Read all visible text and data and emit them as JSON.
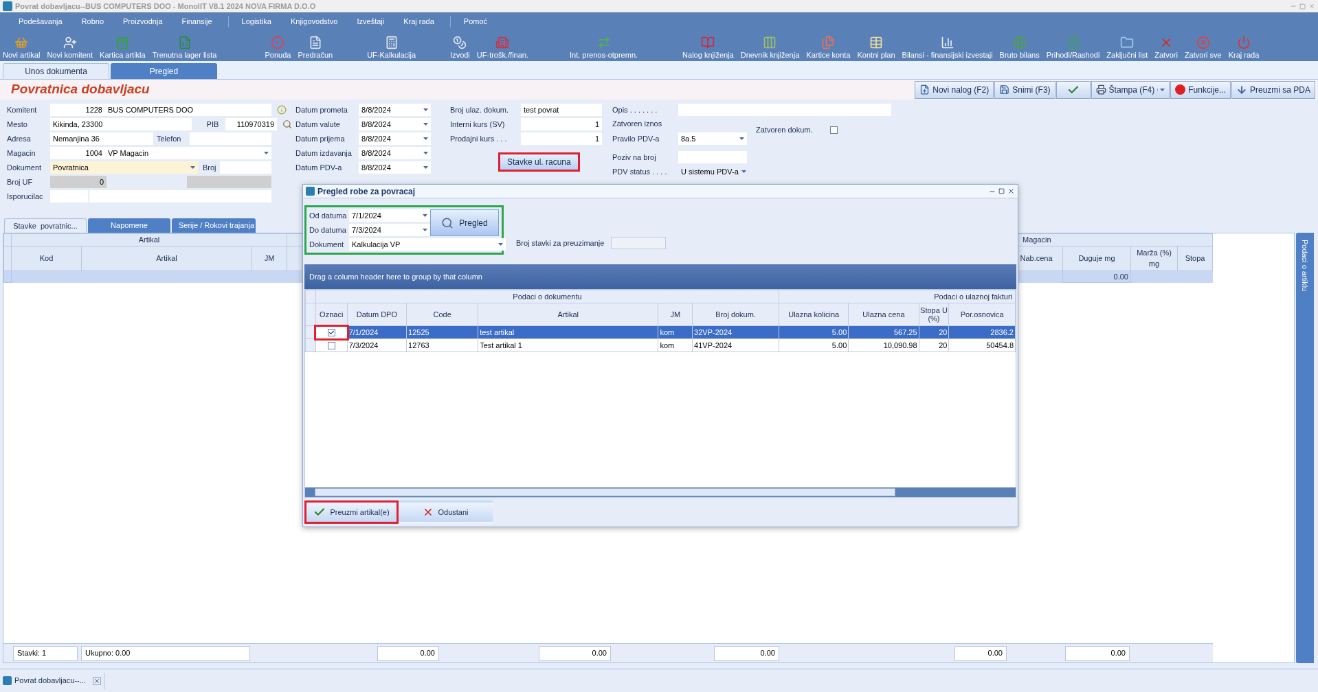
{
  "window": {
    "title": "Povrat dobavljacu--BUS COMPUTERS DOO - MonolIT V8.1 2024 NOVA FIRMA D.O.O"
  },
  "menu": [
    [
      "Podešavanja",
      "Robno",
      "Proizvodnja",
      "Finansije"
    ],
    [
      "Logistika",
      "Knjigovodstvo",
      "Izveštaji",
      "Kraj rada"
    ],
    [
      "Pomoć"
    ]
  ],
  "toolbar": [
    "Novi artikal",
    "Novi komitent",
    "Kartica artikla",
    "Trenutna lager lista",
    "Ponuda",
    "Predračun",
    "UF-Kalkulacija",
    "Izvodi",
    "UF-trošk./finan.",
    "Int. prenos-otpremn.",
    "Nalog knjiženja",
    "Dnevnik knjiženja",
    "Kartice konta",
    "Kontni plan",
    "Bilansi - finansijski izvestaji",
    "Bruto bilans",
    "Prihodi/Rashodi",
    "Zaključni list",
    "Zatvori",
    "Zatvori sve",
    "Kraj rada"
  ],
  "doc_tabs": [
    {
      "label": "Unos dokumenta",
      "selected": true
    },
    {
      "label": "Pregled",
      "selected": false
    }
  ],
  "header": {
    "title": "Povratnica dobavljacu"
  },
  "actions": [
    {
      "kind": "button",
      "label": "Novi nalog (F2)"
    },
    {
      "kind": "button",
      "label": "Snimi (F3)"
    },
    {
      "kind": "confirm"
    },
    {
      "kind": "dropdown",
      "label": "Štampa (F4)"
    },
    {
      "kind": "button",
      "label": "Funkcije..."
    },
    {
      "kind": "button",
      "label": "Preuzmi sa PDA"
    }
  ],
  "partner": {
    "komitent_label": "Komitent",
    "komitent_code": "1228",
    "komitent_name": "BUS COMPUTERS DOO",
    "mesto_label": "Mesto",
    "mesto": "Kikinda, 23300",
    "pib_label": "PIB",
    "pib": "110970319",
    "adresa_label": "Adresa",
    "adresa": "Nemanjina 36",
    "telefon_label": "Telefon",
    "magacin_label": "Magacin",
    "magacin_code": "1004",
    "magacin_name": "VP Magacin",
    "dokument_label": "Dokument",
    "dokument": "Povratnica",
    "broj_label": "Broj",
    "broj_uf_label": "Broj UF",
    "broj_uf": "0",
    "isporucilac_label": "Isporucilac"
  },
  "dates": [
    {
      "label": "Datum prometa",
      "value": "8/8/2024"
    },
    {
      "label": "Datum valute",
      "value": "8/8/2024"
    },
    {
      "label": "Datum prijema",
      "value": "8/8/2024"
    },
    {
      "label": "Datum izdavanja",
      "value": "8/8/2024"
    },
    {
      "label": "Datum PDV-a",
      "value": "8/8/2024"
    }
  ],
  "invoice": {
    "fields": [
      {
        "label": "Broj ulaz. dokum.",
        "value": "test povrat"
      },
      {
        "label": "Interni kurs (SV)",
        "value": "1"
      },
      {
        "label": "Prodajni kurs . . .",
        "value": "1"
      }
    ],
    "button": {
      "label": "Stavke ul. racuna",
      "highlighted": true
    }
  },
  "extra": {
    "opis_label": "Opis . . . . . . .",
    "zatvoren_iznos_label": "Zatvoren iznos",
    "pravilo_label": "Pravilo PDV-a",
    "pravilo": "8a.5",
    "poziv_label": "Poziv na broj",
    "pdv_status_label": "PDV status . . . .",
    "pdv_status": "U sistemu PDV-a",
    "zatvoren_dokum_label": "Zatvoren dokum.",
    "zatvoren_dokum": false
  },
  "sub_tabs": [
    {
      "label": "Stavke  povratnic...",
      "selected": true
    },
    {
      "label": "Napomene",
      "selected": false
    },
    {
      "label": "Serije / Rokovi trajanja",
      "selected": false
    }
  ],
  "items_grid": {
    "left_group": "Artikal",
    "left_columns": [
      "Kod",
      "Artikal",
      "JM"
    ],
    "right_group": "Magacin",
    "right_columns": [
      "Nab.cena",
      "Duguje mg",
      "Marža (%) mg",
      "Stopa"
    ],
    "row_value": "0.00"
  },
  "footer": {
    "count": "Stavki: 1",
    "total": "Ukupno: 0.00",
    "sums": [
      "0.00",
      "0.00",
      "0.00",
      "0.00",
      "0.00"
    ]
  },
  "side_tab": "Podaci o artiklu",
  "taskbar": [
    {
      "label": "Povrat dobavljacu--..."
    }
  ],
  "dialog": {
    "title": "Pregled robe za povracaj",
    "filters": [
      {
        "label": "Od datuma",
        "value": "7/1/2024"
      },
      {
        "label": "Do datuma",
        "value": "7/3/2024"
      }
    ],
    "document_label": "Dokument",
    "document": "Kalkulacija VP",
    "search_button": "Pregled",
    "count_label": "Broj stavki za preuzimanje",
    "group_panel": "Drag a column header here to group by that column",
    "bands": [
      "Podaci o dokumentu",
      "Podaci o ulaznoj fakturi"
    ],
    "check_column": "Oznaci",
    "columns": [
      "Datum DPO",
      "Code",
      "Artikal",
      "JM",
      "Broj dokum.",
      "Ulazna kolicina",
      "Ulazna cena",
      "Stopa U (%)",
      "Por.osnovica"
    ],
    "rows": [
      {
        "checked": true,
        "selected": true,
        "cells": [
          "7/1/2024",
          "12525",
          "test artikal",
          "kom",
          "32VP-2024",
          "5.00",
          "567.25",
          "20",
          "2836.2"
        ]
      },
      {
        "checked": false,
        "selected": false,
        "cells": [
          "7/3/2024",
          "12763",
          "Test artikal 1",
          "kom",
          "41VP-2024",
          "5.00",
          "10,090.98",
          "20",
          "50454.8"
        ]
      }
    ],
    "buttons": [
      {
        "kind": "accept",
        "label": "Preuzmi artikal(e)",
        "highlighted": true
      },
      {
        "kind": "cancel",
        "label": "Odustani",
        "highlighted": false
      }
    ]
  }
}
